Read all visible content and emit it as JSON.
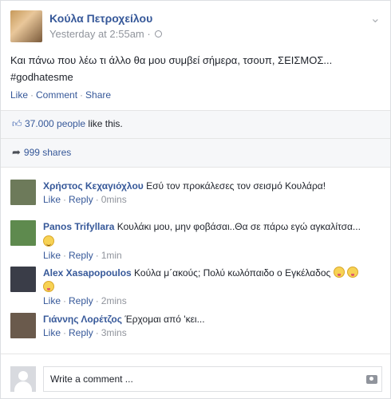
{
  "post": {
    "author": "Κούλα Πετροχείλου",
    "timestamp": "Yesterday at 2:55am",
    "meta_sep": " · ",
    "text": "Και πάνω που λέω τι άλλο θα μου συμβεί σήμερα, τσουπ, ΣΕΙΣΜΟΣ... #godhatesme",
    "actions": {
      "like": "Like",
      "comment": "Comment",
      "share": "Share",
      "sep": "·"
    }
  },
  "stats": {
    "likes_count": "37.000 people",
    "likes_suffix": " like this.",
    "shares": "999 shares"
  },
  "comments": [
    {
      "author": "Χρήστος Κεχαγιόχλου",
      "text": "Εσύ τον προκάλεσες τον σεισμό Κουλάρα!",
      "like": "Like",
      "reply": "Reply",
      "time": "0mins",
      "avatar_color": "#6d7a5a"
    },
    {
      "author": "Panos Trifyllara",
      "text": "Κουλάκι μου, μην φοβάσαι..Θα σε πάρω εγώ αγκαλίτσα...",
      "like": "Like",
      "reply": "Reply",
      "time": "1min",
      "avatar_color": "#5e8a4e"
    },
    {
      "author": "Alex Xasapopoulos",
      "text": "Κούλα μ΄ακούς; Πολύ κωλόπαιδο ο Εγκέλαδος",
      "like": "Like",
      "reply": "Reply",
      "time": "2mins",
      "avatar_color": "#3a3d48"
    },
    {
      "author": "Γιάννης Λορέτζος",
      "text": "Έρχομαι από 'κει...",
      "like": "Like",
      "reply": "Reply",
      "time": "3mins",
      "avatar_color": "#6a5a4c"
    }
  ],
  "composer": {
    "placeholder": "Write a comment ..."
  },
  "colors": {
    "link": "#365899",
    "muted": "#90949c",
    "stats_bg": "#f6f7f9"
  }
}
